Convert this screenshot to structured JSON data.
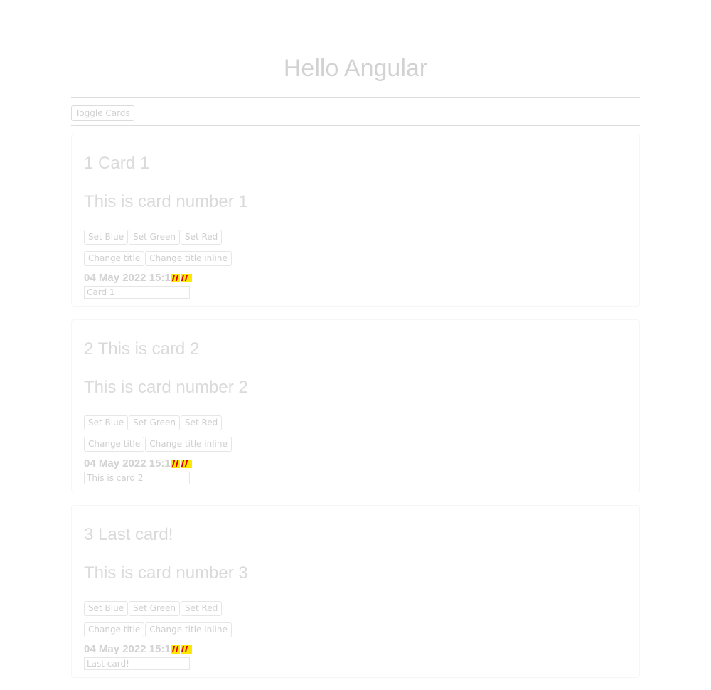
{
  "app": {
    "title": "Hello Angular"
  },
  "toolbar": {
    "toggle_label": "Toggle Cards"
  },
  "buttons": {
    "set_blue": "Set Blue",
    "set_green": "Set Green",
    "set_red": "Set Red",
    "change_title": "Change title",
    "change_title_inline": "Change title inline"
  },
  "cards": [
    {
      "title": "1 Card 1",
      "text": "This is card number 1",
      "date": "04 May 2022 15:1",
      "input_value": "Card 1"
    },
    {
      "title": "2 This is card 2",
      "text": "This is card number 2",
      "date": "04 May 2022 15:1",
      "input_value": "This is card 2"
    },
    {
      "title": "3 Last card!",
      "text": "This is card number 3",
      "date": "04 May 2022 15:1",
      "input_value": "Last card!"
    }
  ],
  "icons": {
    "broken_image": "broken-image-icon"
  },
  "colors": {
    "text_faded": "#d2d2d2",
    "broken_icon_yellow": "#ffe900",
    "broken_icon_red": "#e00000"
  }
}
